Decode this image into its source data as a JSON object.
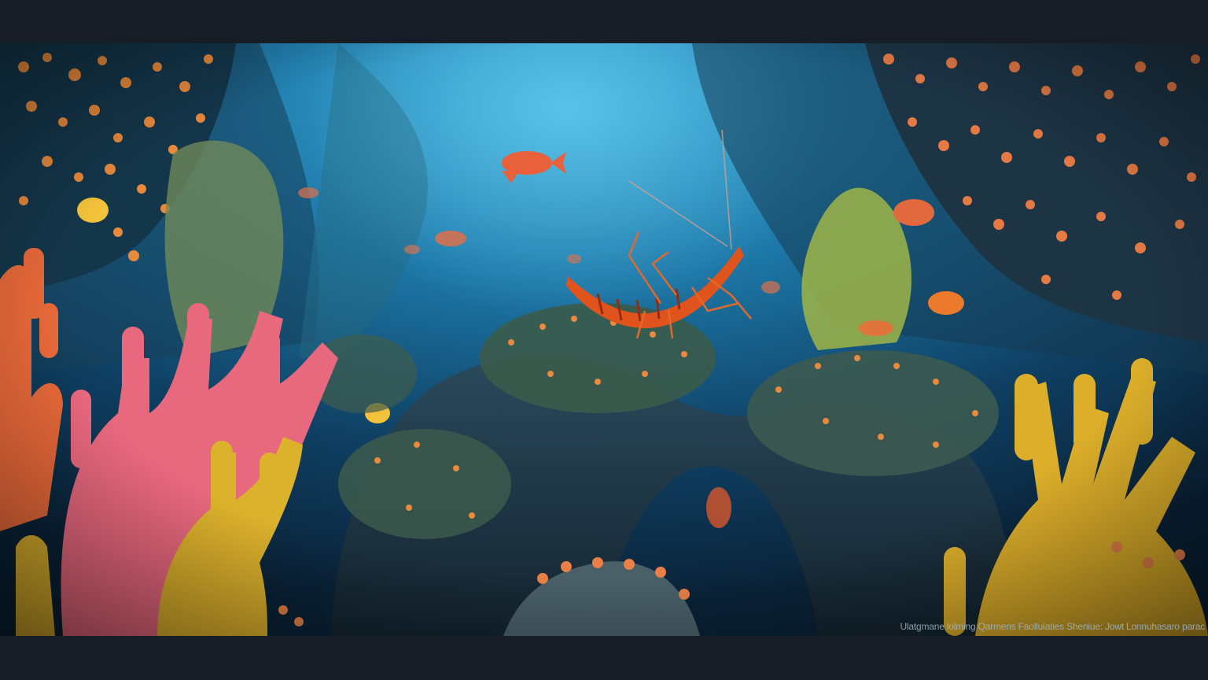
{
  "image": {
    "caption": "Ulatgmane lolming Qarmens Faollulaties Sheniue: Jowt Lonnuhasaro parac"
  },
  "colors": {
    "letterbox": "#161d25",
    "water_light": "#2f9fd0",
    "water_deep": "#0b2a44",
    "shrimp": "#e0531c",
    "coral_pink": "#e8607a",
    "coral_yellow": "#e1b52b",
    "coral_orange": "#e8703a",
    "rock": "#1e3444"
  },
  "icons": [
    "shrimp",
    "fish",
    "branching-coral",
    "sea-fan",
    "rock-arch"
  ]
}
